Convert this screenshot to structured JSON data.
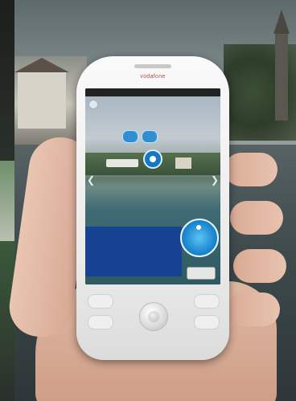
{
  "phone": {
    "brand": "vodafone",
    "status_bar": "",
    "info_panel": {
      "title": "",
      "lines": [],
      "link": ""
    }
  },
  "colors": {
    "ar_blue": "#1677c4",
    "info_panel_blue": "#124096",
    "phone_white": "#f4f4f4"
  },
  "icons": [
    "menu-icon",
    "ar-marker-icon",
    "ar-selected-ring-icon",
    "left-arrow-icon",
    "right-arrow-icon",
    "radar-icon",
    "trackball-icon"
  ]
}
